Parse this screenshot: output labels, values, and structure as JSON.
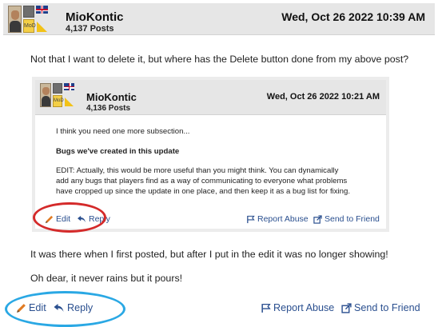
{
  "post": {
    "username": "MioKontic",
    "post_count": "4,137 Posts",
    "date": "Wed, Oct 26 2022 10:39 AM",
    "avatar_badge": "MoD",
    "body": [
      "Not that I want to delete it, but where has the Delete button done from my above post?",
      "It was there when I first posted, but after I put in the edit it was no longer showing!",
      "Oh dear, it never rains but it pours!"
    ],
    "actions": {
      "edit": "Edit",
      "reply": "Reply",
      "report": "Report Abuse",
      "send": "Send to Friend"
    }
  },
  "quoted": {
    "username": "MioKontic",
    "post_count": "4,136 Posts",
    "date": "Wed, Oct 26 2022 10:21 AM",
    "avatar_badge": "MoD",
    "body": [
      "I think you need one more subsection...",
      "Bugs we've created in this update",
      "EDIT:  Actually, this would be more useful than you might think.  You can dynamically",
      "add any bugs that players find as a way of communicating to everyone what problems",
      "have cropped up since the update in one place, and then keep it as a bug list for fixing."
    ],
    "actions": {
      "edit": "Edit",
      "reply": "Reply",
      "report": "Report Abuse",
      "send": "Send to Friend"
    }
  },
  "annotations": {
    "inner_circle_color": "#d42a2a",
    "outer_circle_color": "#2aa8e4"
  },
  "colors": {
    "link": "#2a4f8f",
    "header_bg": "#e6e6e6"
  }
}
